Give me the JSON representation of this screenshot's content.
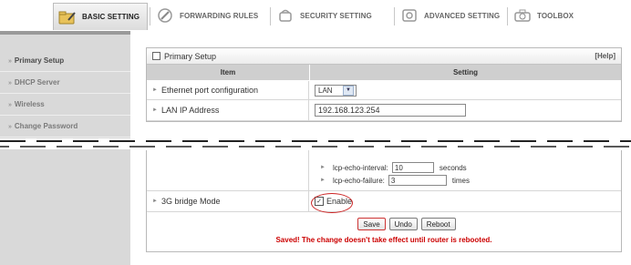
{
  "nav": {
    "tabs": [
      {
        "label": "BASIC SETTING",
        "icon": "folder-pencil-icon"
      },
      {
        "label": "FORWARDING RULES",
        "icon": "wrench-icon"
      },
      {
        "label": "SECURITY SETTING",
        "icon": "shield-icon"
      },
      {
        "label": "ADVANCED SETTING",
        "icon": "gear-icon"
      },
      {
        "label": "TOOLBOX",
        "icon": "toolbox-icon"
      }
    ]
  },
  "sidebar": {
    "items": [
      {
        "label": "Primary Setup"
      },
      {
        "label": "DHCP Server"
      },
      {
        "label": "Wireless"
      },
      {
        "label": "Change Password"
      }
    ]
  },
  "panel": {
    "title": "Primary Setup",
    "help": "[Help]",
    "col_item": "Item",
    "col_setting": "Setting",
    "rows": {
      "eth_label": "Ethernet port configuration",
      "eth_value": "LAN",
      "lan_ip_label": "LAN IP Address",
      "lan_ip_value": "192.168.123.254",
      "lcp_interval_label": "lcp-echo-interval:",
      "lcp_interval_value": "10",
      "lcp_interval_unit": "seconds",
      "lcp_failure_label": "lcp-echo-failure:",
      "lcp_failure_value": "3",
      "lcp_failure_unit": "times",
      "bridge_label": "3G bridge Mode",
      "bridge_checkbox_label": "Enable"
    },
    "buttons": {
      "save": "Save",
      "undo": "Undo",
      "reboot": "Reboot"
    },
    "saved_message": "Saved! The change doesn't take effect until router is rebooted."
  },
  "colors": {
    "sidebar_bg": "#d9d9d9",
    "header_bg": "#cfcfcf",
    "alert": "#cc0000"
  }
}
